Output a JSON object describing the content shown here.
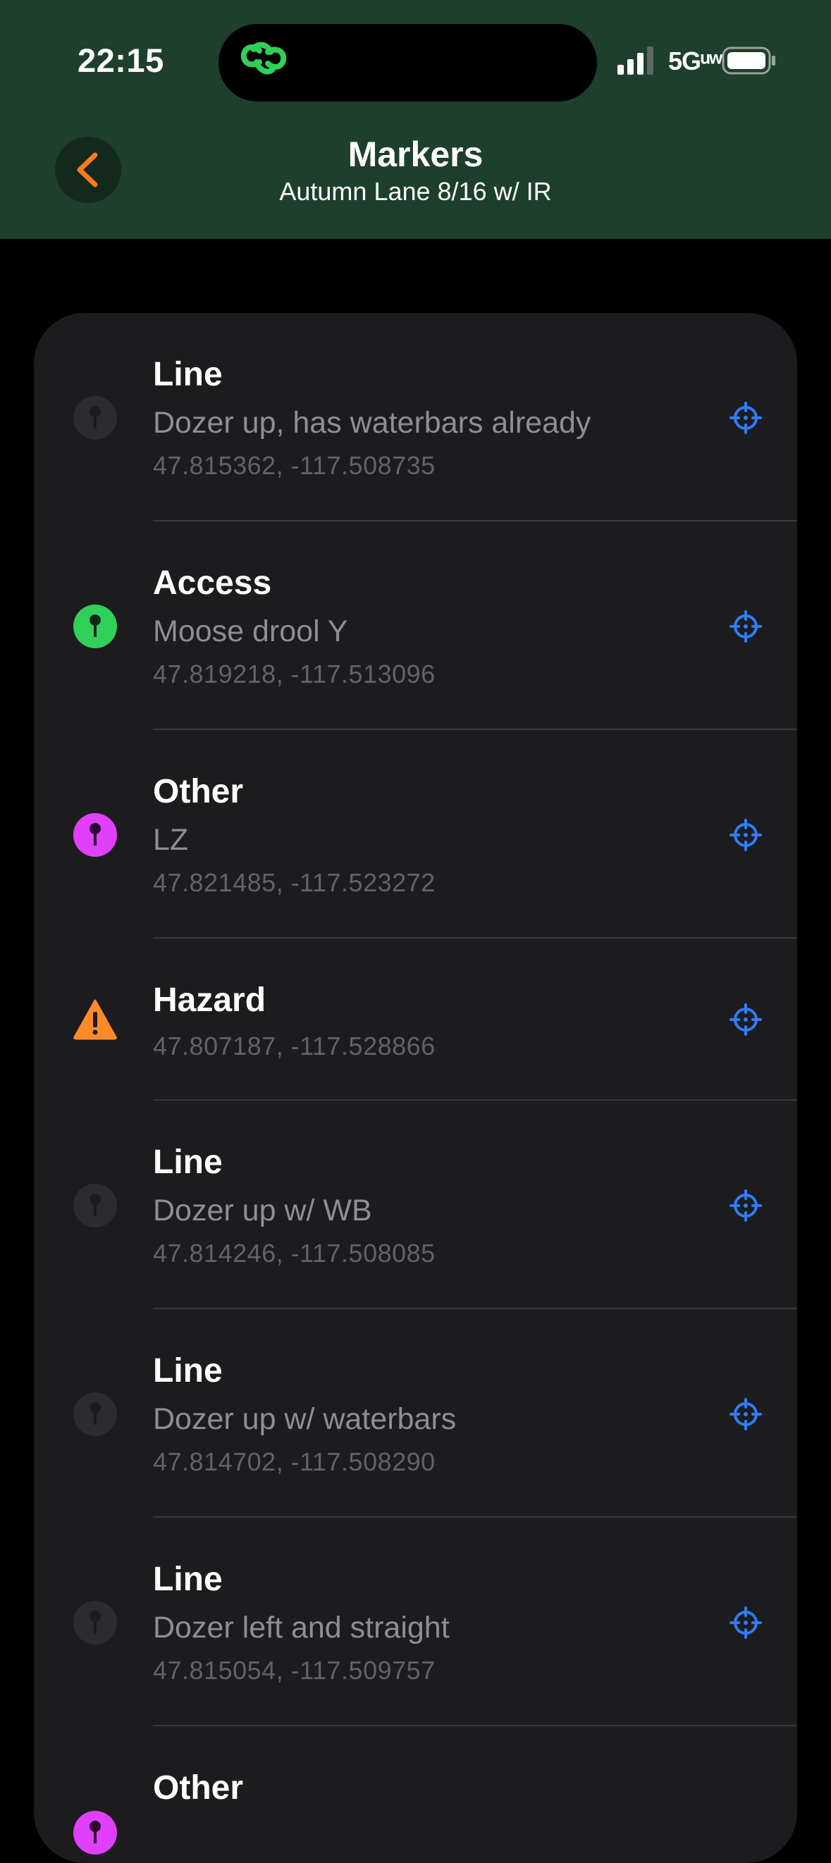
{
  "status_bar": {
    "time": "22:15",
    "network": "5Gᵘʷ"
  },
  "header": {
    "title": "Markers",
    "subtitle": "Autumn Lane 8/16 w/ IR"
  },
  "colors": {
    "header_bg": "#1e3f2c",
    "accent_back": "#ff7a1a",
    "locate_blue": "#2f7df6",
    "access_green": "#30d158",
    "other_magenta": "#e040fb",
    "hazard_orange": "#ff8a2a",
    "line_dim": "#2c2c2e"
  },
  "markers": [
    {
      "type": "Line",
      "description": "Dozer up, has waterbars already",
      "coords": "47.815362, -117.508735",
      "icon": "line-pin-icon"
    },
    {
      "type": "Access",
      "description": "Moose drool Y",
      "coords": "47.819218, -117.513096",
      "icon": "access-pin-icon"
    },
    {
      "type": "Other",
      "description": "LZ",
      "coords": "47.821485, -117.523272",
      "icon": "other-pin-icon"
    },
    {
      "type": "Hazard",
      "description": "",
      "coords": "47.807187, -117.528866",
      "icon": "hazard-warning-icon"
    },
    {
      "type": "Line",
      "description": "Dozer up w/ WB",
      "coords": "47.814246, -117.508085",
      "icon": "line-pin-icon"
    },
    {
      "type": "Line",
      "description": "Dozer up w/ waterbars",
      "coords": "47.814702, -117.508290",
      "icon": "line-pin-icon"
    },
    {
      "type": "Line",
      "description": "Dozer left and straight",
      "coords": "47.815054, -117.509757",
      "icon": "line-pin-icon"
    },
    {
      "type": "Other",
      "description": "",
      "coords": "",
      "icon": "other-pin-icon"
    }
  ]
}
